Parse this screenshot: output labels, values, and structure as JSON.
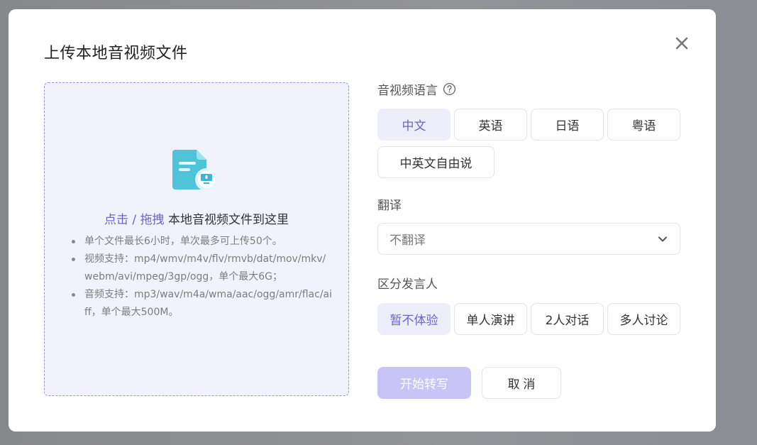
{
  "modal": {
    "title": "上传本地音视频文件"
  },
  "icons": {
    "close": "close-icon",
    "file": "audio-file-icon",
    "help": "question-circle-icon",
    "dropdown": "chevron-down-icon"
  },
  "colors": {
    "accent": "#6b63cc",
    "dropzone_bg": "#f2f2fc",
    "primary_disabled": "#c8c5f6",
    "chip_active_bg": "#eeeefb"
  },
  "upload": {
    "click_label": "点击",
    "separator": " / ",
    "drag_label": "拖拽",
    "hint_text": " 本地音视频文件到这里",
    "rules": [
      "单个文件最长6小时，单次最多可上传50个。",
      "视频支持：mp4/wmv/m4v/flv/rmvb/dat/mov/mkv/webm/avi/mpeg/3gp/ogg，单个最大6G；",
      "音频支持：mp3/wav/m4a/wma/aac/ogg/amr/flac/aiff，单个最大500M。"
    ]
  },
  "language": {
    "label": "音视频语言",
    "options": [
      "中文",
      "英语",
      "日语",
      "粤语",
      "中英文自由说"
    ],
    "selected": "中文"
  },
  "translate": {
    "label": "翻译",
    "value": "不翻译"
  },
  "speaker": {
    "label": "区分发言人",
    "options": [
      "暂不体验",
      "单人演讲",
      "2人对话",
      "多人讨论"
    ],
    "selected": "暂不体验"
  },
  "actions": {
    "start_label": "开始转写",
    "cancel_label": "取 消"
  }
}
